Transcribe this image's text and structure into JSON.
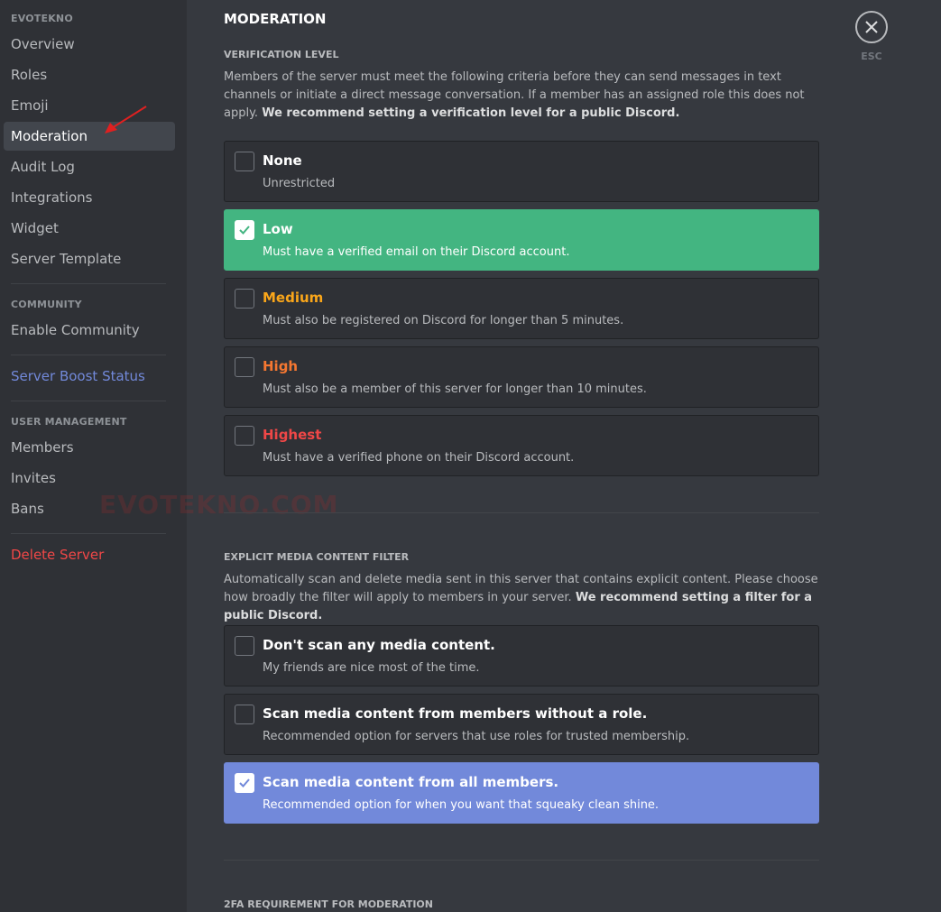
{
  "sidebar": {
    "server_heading": "EVOTEKNO",
    "items": [
      {
        "label": "Overview"
      },
      {
        "label": "Roles"
      },
      {
        "label": "Emoji"
      },
      {
        "label": "Moderation"
      },
      {
        "label": "Audit Log"
      },
      {
        "label": "Integrations"
      },
      {
        "label": "Widget"
      },
      {
        "label": "Server Template"
      }
    ],
    "community_heading": "COMMUNITY",
    "enable_community": "Enable Community",
    "server_boost": "Server Boost Status",
    "user_management_heading": "USER MANAGEMENT",
    "user_items": [
      {
        "label": "Members"
      },
      {
        "label": "Invites"
      },
      {
        "label": "Bans"
      }
    ],
    "delete_server": "Delete Server",
    "selected": "Moderation"
  },
  "watermark": "EVOTEKNO.COM",
  "main": {
    "title": "MODERATION",
    "verification": {
      "heading": "VERIFICATION LEVEL",
      "description": "Members of the server must meet the following criteria before they can send messages in text channels or initiate a direct message conversation. If a member has an assigned role this does not apply.",
      "recommendation": "We recommend setting a verification level for a public Discord.",
      "options": [
        {
          "title": "None",
          "subtitle": "Unrestricted",
          "checked": false,
          "color": "#ffffff"
        },
        {
          "title": "Low",
          "subtitle": "Must have a verified email on their Discord account.",
          "checked": true,
          "color": "#ffffff"
        },
        {
          "title": "Medium",
          "subtitle": "Must also be registered on Discord for longer than 5 minutes.",
          "checked": false,
          "color": "#faa61a"
        },
        {
          "title": "High",
          "subtitle": "Must also be a member of this server for longer than 10 minutes.",
          "checked": false,
          "color": "#f57731"
        },
        {
          "title": "Highest",
          "subtitle": "Must have a verified phone on their Discord account.",
          "checked": false,
          "color": "#f04747"
        }
      ]
    },
    "explicit_filter": {
      "heading": "EXPLICIT MEDIA CONTENT FILTER",
      "description": "Automatically scan and delete media sent in this server that contains explicit content. Please choose how broadly the filter will apply to members in your server.",
      "recommendation": "We recommend setting a filter for a public Discord.",
      "options": [
        {
          "title": "Don't scan any media content.",
          "subtitle": "My friends are nice most of the time.",
          "checked": false
        },
        {
          "title": "Scan media content from members without a role.",
          "subtitle": "Recommended option for servers that use roles for trusted membership.",
          "checked": false
        },
        {
          "title": "Scan media content from all members.",
          "subtitle": "Recommended option for when you want that squeaky clean shine.",
          "checked": true
        }
      ]
    },
    "twofa_heading": "2FA REQUIREMENT FOR MODERATION"
  },
  "close": {
    "label": "ESC",
    "icon": "close-icon"
  },
  "colors": {
    "background": "#36393f",
    "sidebar": "#2f3136",
    "selected_green": "#43b581",
    "selected_blurple": "#7289da",
    "danger": "#f04747"
  }
}
